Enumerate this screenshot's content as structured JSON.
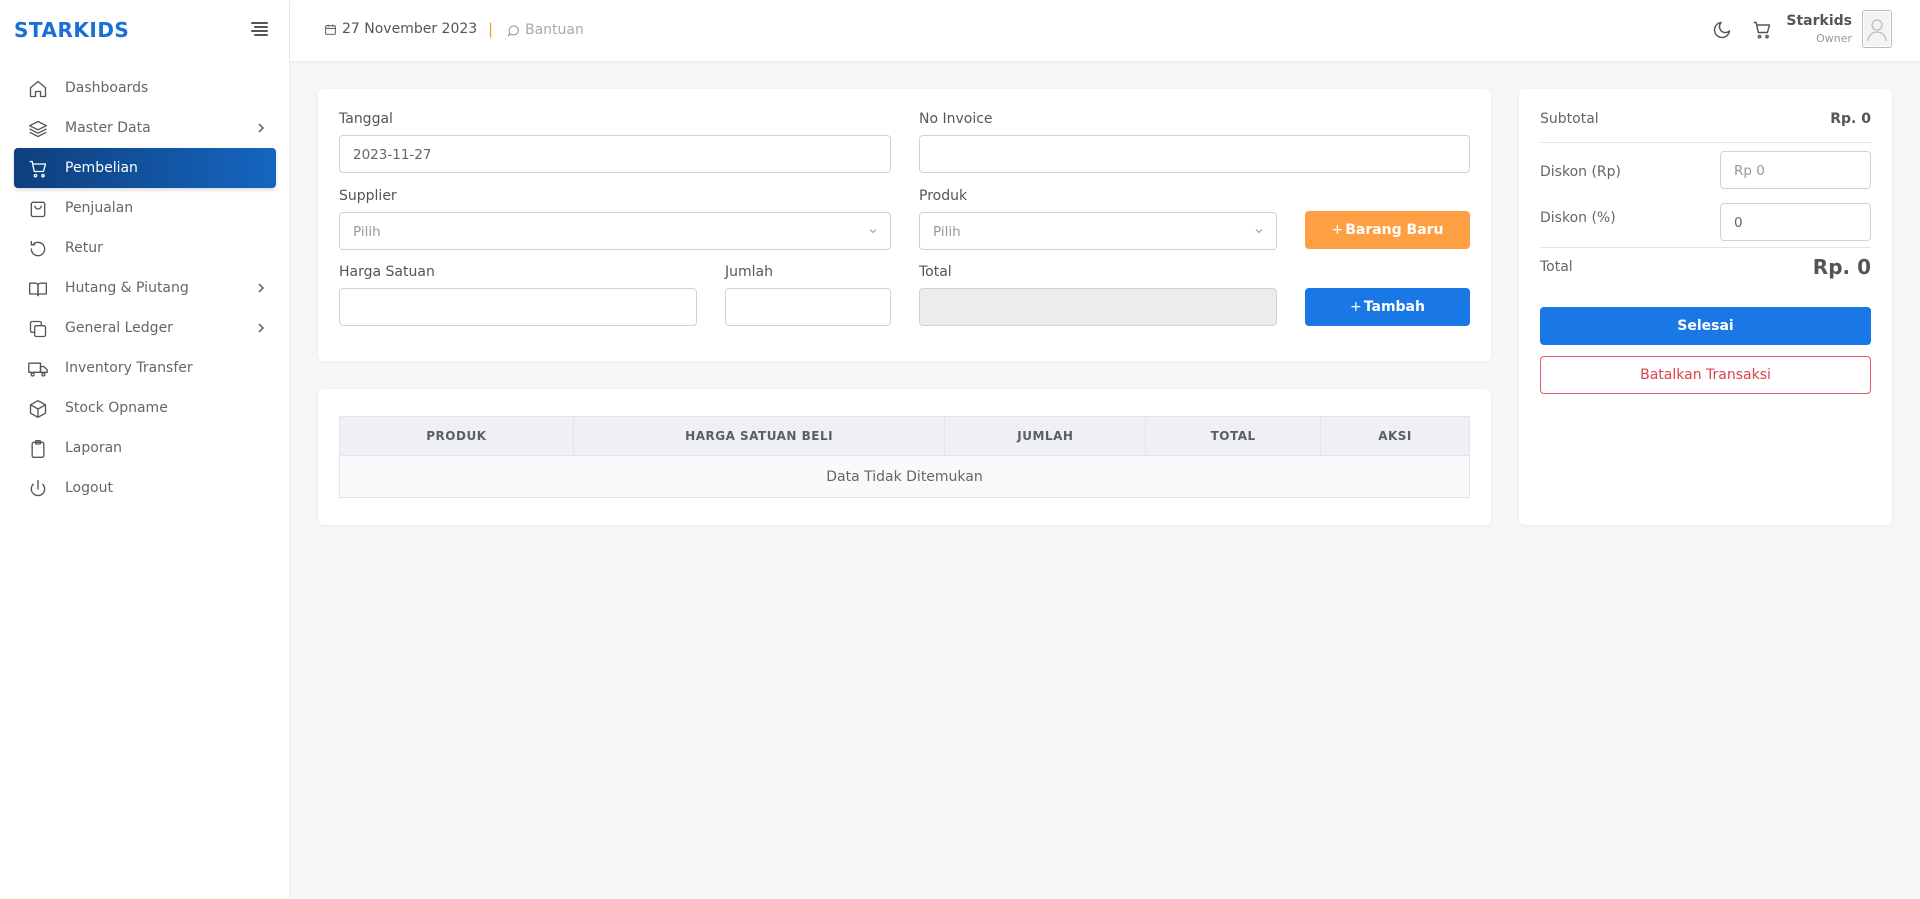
{
  "brand": "STARKIDS",
  "sidebar": {
    "items": [
      {
        "label": "Dashboards",
        "icon": "home-icon",
        "chevron": false,
        "active": false
      },
      {
        "label": "Master Data",
        "icon": "layers-icon",
        "chevron": true,
        "active": false
      },
      {
        "label": "Pembelian",
        "icon": "cart-icon",
        "chevron": false,
        "active": true
      },
      {
        "label": "Penjualan",
        "icon": "shopping-bag-icon",
        "chevron": false,
        "active": false
      },
      {
        "label": "Retur",
        "icon": "rotate-icon",
        "chevron": false,
        "active": false
      },
      {
        "label": "Hutang & Piutang",
        "icon": "book-icon",
        "chevron": true,
        "active": false
      },
      {
        "label": "General Ledger",
        "icon": "copy-icon",
        "chevron": true,
        "active": false
      },
      {
        "label": "Inventory Transfer",
        "icon": "truck-icon",
        "chevron": false,
        "active": false
      },
      {
        "label": "Stock Opname",
        "icon": "box-icon",
        "chevron": false,
        "active": false
      },
      {
        "label": "Laporan",
        "icon": "clipboard-icon",
        "chevron": false,
        "active": false
      },
      {
        "label": "Logout",
        "icon": "power-icon",
        "chevron": false,
        "active": false
      }
    ]
  },
  "topbar": {
    "date": "27 November 2023",
    "separator": "|",
    "help": "Bantuan",
    "user_name": "Starkids",
    "user_role": "Owner"
  },
  "form": {
    "tanggal_label": "Tanggal",
    "tanggal_value": "2023-11-27",
    "invoice_label": "No Invoice",
    "invoice_value": "",
    "supplier_label": "Supplier",
    "supplier_value": "Pilih",
    "produk_label": "Produk",
    "produk_value": "Pilih",
    "barang_baru_label": "Barang Baru",
    "harga_label": "Harga Satuan",
    "harga_value": "",
    "jumlah_label": "Jumlah",
    "jumlah_value": "",
    "total_label": "Total",
    "total_value": "",
    "tambah_label": "Tambah"
  },
  "table": {
    "headers": [
      "PRODUK",
      "HARGA SATUAN BELI",
      "JUMLAH",
      "TOTAL",
      "AKSI"
    ],
    "empty_text": "Data Tidak Ditemukan"
  },
  "summary": {
    "subtotal_label": "Subtotal",
    "subtotal_value": "Rp. 0",
    "diskon_rp_label": "Diskon (Rp)",
    "diskon_rp_placeholder": "Rp 0",
    "diskon_pct_label": "Diskon (%)",
    "diskon_pct_value": "0",
    "total_label": "Total",
    "total_value": "Rp. 0",
    "selesai_label": "Selesai",
    "batalkan_label": "Batalkan Transaksi"
  },
  "colors": {
    "brand": "#1a6fd6",
    "active_menu": "#1565c0",
    "orange_button": "#ff9f43",
    "blue_button": "#1a78e6",
    "cancel_red": "#d9434e"
  }
}
